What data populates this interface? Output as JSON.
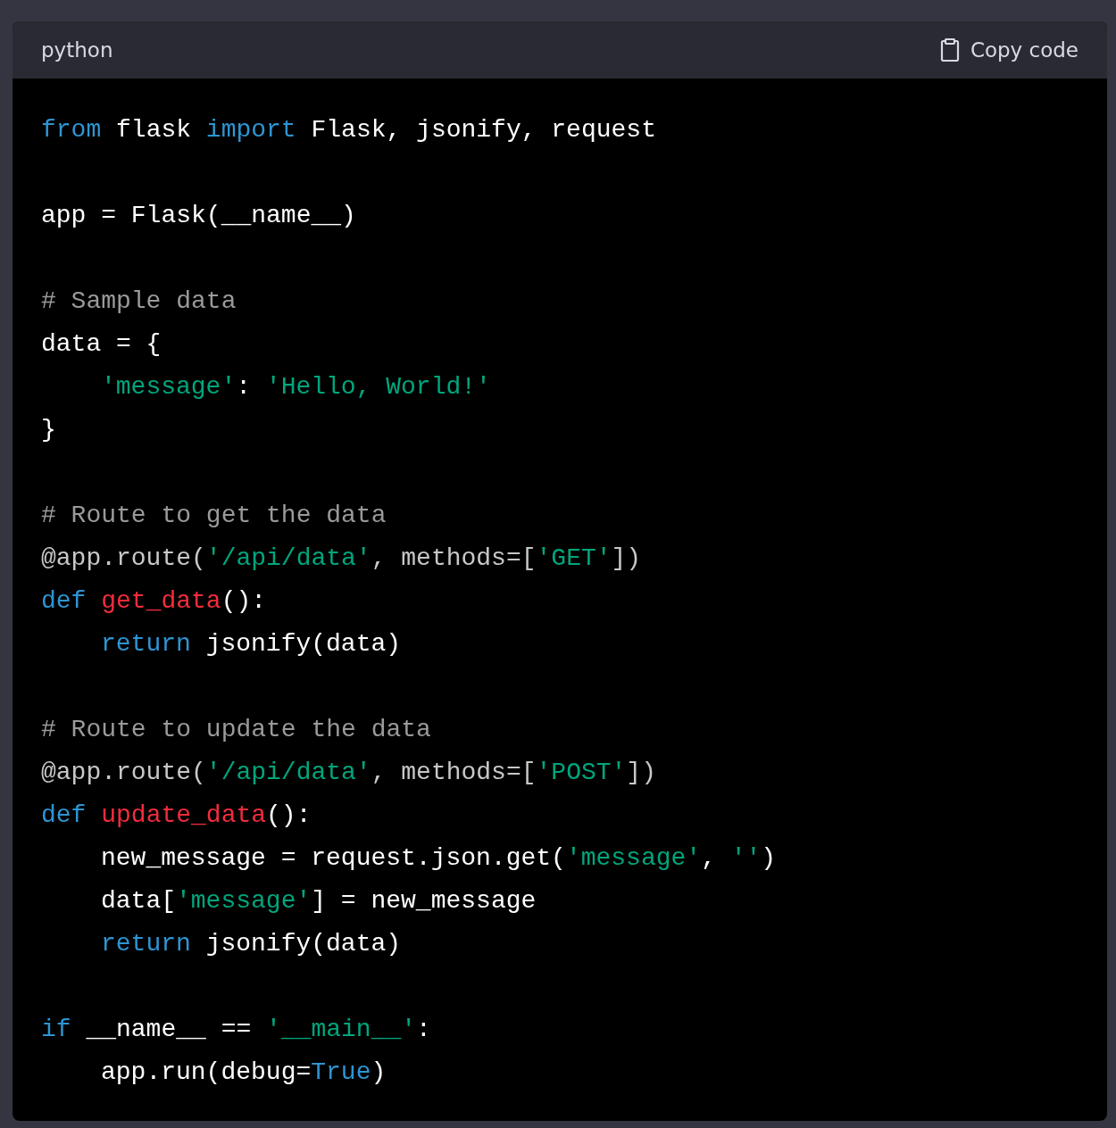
{
  "code_block": {
    "language": "python",
    "copy_button": {
      "label": "Copy code"
    },
    "lines": [
      {
        "kind": "code",
        "indented": false,
        "tokens": [
          {
            "kind": "keyword",
            "text": "from"
          },
          {
            "kind": "plain",
            "text": " flask "
          },
          {
            "kind": "keyword",
            "text": "import"
          },
          {
            "kind": "plain",
            "text": " Flask, jsonify, request"
          }
        ]
      },
      {
        "kind": "blank"
      },
      {
        "kind": "code",
        "indented": false,
        "tokens": [
          {
            "kind": "plain",
            "text": "app = Flask(__name__)"
          }
        ]
      },
      {
        "kind": "blank"
      },
      {
        "kind": "code",
        "indented": false,
        "tokens": [
          {
            "kind": "comment",
            "text": "# Sample data"
          }
        ]
      },
      {
        "kind": "code",
        "indented": false,
        "tokens": [
          {
            "kind": "plain",
            "text": "data = {"
          }
        ]
      },
      {
        "kind": "code",
        "indented": true,
        "tokens": [
          {
            "kind": "string",
            "text": "'message'"
          },
          {
            "kind": "plain",
            "text": ": "
          },
          {
            "kind": "string",
            "text": "'Hello, World!'"
          }
        ]
      },
      {
        "kind": "code",
        "indented": false,
        "tokens": [
          {
            "kind": "plain",
            "text": "}"
          }
        ]
      },
      {
        "kind": "blank"
      },
      {
        "kind": "code",
        "indented": false,
        "tokens": [
          {
            "kind": "comment",
            "text": "# Route to get the data"
          }
        ]
      },
      {
        "kind": "code",
        "indented": false,
        "tokens": [
          {
            "kind": "decorator",
            "text": "@app.route("
          },
          {
            "kind": "string",
            "text": "'/api/data'"
          },
          {
            "kind": "decorator",
            "text": ", methods=["
          },
          {
            "kind": "string",
            "text": "'GET'"
          },
          {
            "kind": "decorator",
            "text": "])"
          }
        ]
      },
      {
        "kind": "code",
        "indented": false,
        "tokens": [
          {
            "kind": "keyword",
            "text": "def "
          },
          {
            "kind": "function",
            "text": "get_data"
          },
          {
            "kind": "plain",
            "text": "():"
          }
        ]
      },
      {
        "kind": "code",
        "indented": true,
        "tokens": [
          {
            "kind": "keyword",
            "text": "return"
          },
          {
            "kind": "plain",
            "text": " jsonify(data)"
          }
        ]
      },
      {
        "kind": "blank"
      },
      {
        "kind": "code",
        "indented": false,
        "tokens": [
          {
            "kind": "comment",
            "text": "# Route to update the data"
          }
        ]
      },
      {
        "kind": "code",
        "indented": false,
        "tokens": [
          {
            "kind": "decorator",
            "text": "@app.route("
          },
          {
            "kind": "string",
            "text": "'/api/data'"
          },
          {
            "kind": "decorator",
            "text": ", methods=["
          },
          {
            "kind": "string",
            "text": "'POST'"
          },
          {
            "kind": "decorator",
            "text": "])"
          }
        ]
      },
      {
        "kind": "code",
        "indented": false,
        "tokens": [
          {
            "kind": "keyword",
            "text": "def "
          },
          {
            "kind": "function",
            "text": "update_data"
          },
          {
            "kind": "plain",
            "text": "():"
          }
        ]
      },
      {
        "kind": "code",
        "indented": true,
        "tokens": [
          {
            "kind": "plain",
            "text": "new_message = request.json.get("
          },
          {
            "kind": "string",
            "text": "'message'"
          },
          {
            "kind": "plain",
            "text": ", "
          },
          {
            "kind": "string",
            "text": "''"
          },
          {
            "kind": "plain",
            "text": ")"
          }
        ]
      },
      {
        "kind": "code",
        "indented": true,
        "tokens": [
          {
            "kind": "plain",
            "text": "data["
          },
          {
            "kind": "string",
            "text": "'message'"
          },
          {
            "kind": "plain",
            "text": "] = new_message"
          }
        ]
      },
      {
        "kind": "code",
        "indented": true,
        "tokens": [
          {
            "kind": "keyword",
            "text": "return"
          },
          {
            "kind": "plain",
            "text": " jsonify(data)"
          }
        ]
      },
      {
        "kind": "blank"
      },
      {
        "kind": "code",
        "indented": false,
        "tokens": [
          {
            "kind": "keyword",
            "text": "if"
          },
          {
            "kind": "plain",
            "text": " __name__ == "
          },
          {
            "kind": "string",
            "text": "'__main__'"
          },
          {
            "kind": "plain",
            "text": ":"
          }
        ]
      },
      {
        "kind": "code",
        "indented": true,
        "tokens": [
          {
            "kind": "plain",
            "text": "app.run(debug="
          },
          {
            "kind": "keyword",
            "text": "True"
          },
          {
            "kind": "plain",
            "text": ")"
          }
        ]
      }
    ]
  }
}
